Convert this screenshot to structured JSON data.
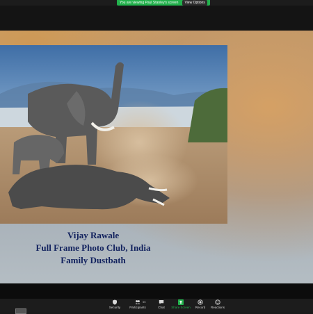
{
  "banner": {
    "share_notice": "You are viewing Paul Stanley's screen",
    "view_options": "View Options"
  },
  "slide": {
    "caption_line1": "Vijay Rawale",
    "caption_line2": "Full Frame Photo Club, India",
    "caption_line3": "Family Dustbath"
  },
  "toolbar": {
    "security": "Security",
    "participants": "Participants",
    "participants_count": "55",
    "chat": "Chat",
    "share_screen": "Share Screen",
    "record": "Record",
    "reactions": "Reactions"
  },
  "colors": {
    "accent_green": "#22b14c",
    "caption_blue": "#12225e"
  }
}
